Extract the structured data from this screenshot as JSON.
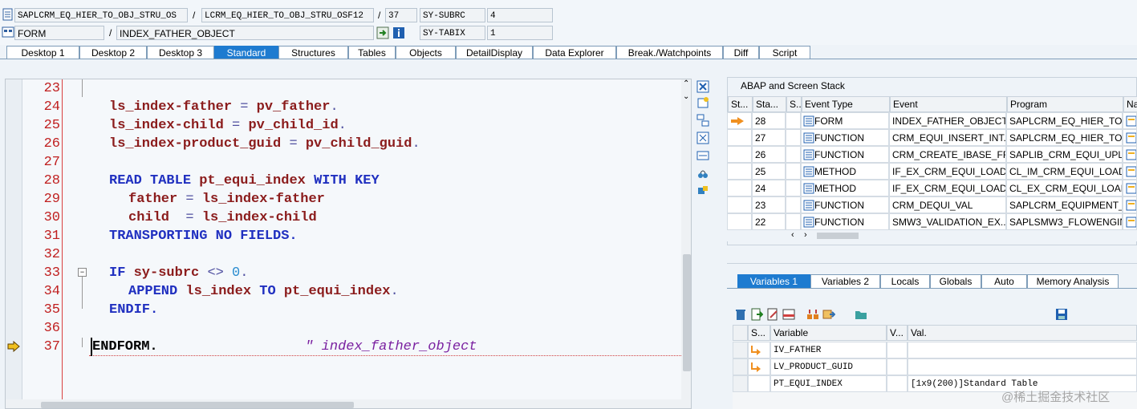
{
  "header": {
    "row1": {
      "program": "SAPLCRM_EQ_HIER_TO_OBJ_STRU_OS",
      "include": "LCRM_EQ_HIER_TO_OBJ_STRU_OSF12",
      "line": "37",
      "sysvar1_name": "SY-SUBRC",
      "sysvar1_value": "4"
    },
    "row2": {
      "type": "FORM",
      "name": "INDEX_FATHER_OBJECT",
      "sysvar2_name": "SY-TABIX",
      "sysvar2_value": "1"
    },
    "separator": "/"
  },
  "tabs": [
    "Desktop 1",
    "Desktop 2",
    "Desktop 3",
    "Standard",
    "Structures",
    "Tables",
    "Objects",
    "DetailDisplay",
    "Data Explorer",
    "Break./Watchpoints",
    "Diff",
    "Script"
  ],
  "active_tab": "Standard",
  "editor": {
    "lines": [
      {
        "n": "23"
      },
      {
        "n": "24"
      },
      {
        "n": "25"
      },
      {
        "n": "26"
      },
      {
        "n": "27"
      },
      {
        "n": "28"
      },
      {
        "n": "29"
      },
      {
        "n": "30"
      },
      {
        "n": "31"
      },
      {
        "n": "32"
      },
      {
        "n": "33"
      },
      {
        "n": "34"
      },
      {
        "n": "35"
      },
      {
        "n": "36"
      },
      {
        "n": "37"
      }
    ],
    "code": {
      "l24a": "ls_index-father",
      "l24b": "=",
      "l24c": "pv_father",
      "l24d": ".",
      "l25a": "ls_index-child",
      "l25b": "=",
      "l25c": "pv_child_id",
      "l25d": ".",
      "l26a": "ls_index-product_guid",
      "l26b": "=",
      "l26c": "pv_child_guid",
      "l26d": ".",
      "l28a": "READ TABLE",
      "l28b": "pt_equi_index",
      "l28c": "WITH KEY",
      "l29a": "father",
      "l29b": "=",
      "l29c": "ls_index-father",
      "l30a": "child",
      "l30b": "=",
      "l30c": "ls_index-child",
      "l31a": "TRANSPORTING NO FIELDS.",
      "l33a": "IF",
      "l33b": "sy-subrc",
      "l33c": "<>",
      "l33d": "0",
      "l33e": ".",
      "l34a": "APPEND",
      "l34b": "ls_index",
      "l34c": "TO",
      "l34d": "pt_equi_index",
      "l34e": ".",
      "l35a": "ENDIF.",
      "l37a": "ENDFORM.",
      "l37b": "\" index_father_object"
    }
  },
  "stack": {
    "title": "ABAP and Screen Stack",
    "columns": [
      "St...",
      "Sta...",
      "S...",
      "Event Type",
      "Event",
      "Program",
      "Na"
    ],
    "rows": [
      {
        "level": "28",
        "type": "FORM",
        "event": "INDEX_FATHER_OBJECT",
        "program": "SAPLCRM_EQ_HIER_TO_..."
      },
      {
        "level": "27",
        "type": "FUNCTION",
        "event": "CRM_EQUI_INSERT_INT...",
        "program": "SAPLCRM_EQ_HIER_TO_..."
      },
      {
        "level": "26",
        "type": "FUNCTION",
        "event": "CRM_CREATE_IBASE_FR...",
        "program": "SAPLIB_CRM_EQUI_UPL..."
      },
      {
        "level": "25",
        "type": "METHOD",
        "event": "IF_EX_CRM_EQUI_LOAD...",
        "program": "CL_IM_CRM_EQUI_LOAD..."
      },
      {
        "level": "24",
        "type": "METHOD",
        "event": "IF_EX_CRM_EQUI_LOAD...",
        "program": "CL_EX_CRM_EQUI_LOAD..."
      },
      {
        "level": "23",
        "type": "FUNCTION",
        "event": "CRM_DEQUI_VAL",
        "program": "SAPLCRM_EQUIPMENT_..."
      },
      {
        "level": "22",
        "type": "FUNCTION",
        "event": "SMW3_VALIDATION_EX...",
        "program": "SAPLSMW3_FLOWENGIN..."
      }
    ]
  },
  "var_tabs": [
    "Variables 1",
    "Variables 2",
    "Locals",
    "Globals",
    "Auto",
    "Memory Analysis"
  ],
  "var_active": "Variables 1",
  "variables": {
    "columns": [
      "S...",
      "Variable",
      "V...",
      "Val."
    ],
    "rows": [
      {
        "name": "IV_FATHER",
        "value": ""
      },
      {
        "name": "LV_PRODUCT_GUID",
        "value": ""
      },
      {
        "name": "PT_EQUI_INDEX",
        "value": "[1x9(200)]Standard Table"
      }
    ]
  },
  "watermark": "@稀土掘金技术社区",
  "colors": {
    "accent": "#1e7bd0",
    "line_number": "#c02020",
    "keyword": "#2030c0",
    "identifier": "#8b1c1c",
    "comment": "#7a20a0"
  }
}
